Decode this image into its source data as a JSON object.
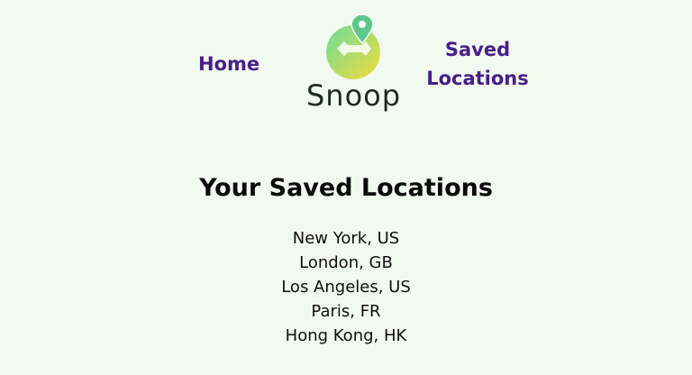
{
  "nav": {
    "home_label": "Home",
    "saved_line1": "Saved",
    "saved_line2": "Locations"
  },
  "logo": {
    "text": "Snoop",
    "icon": "map-pin-icon"
  },
  "main": {
    "title": "Your Saved Locations",
    "locations": [
      "New York, US",
      "London, GB",
      "Los Angeles, US",
      "Paris, FR",
      "Hong Kong, HK"
    ]
  },
  "colors": {
    "background": "#f1faee",
    "nav_link": "#4a1d8a",
    "logo_gradient_start": "#6fdc9a",
    "logo_gradient_end": "#f2dc3a",
    "pin": "#5cc88a"
  }
}
